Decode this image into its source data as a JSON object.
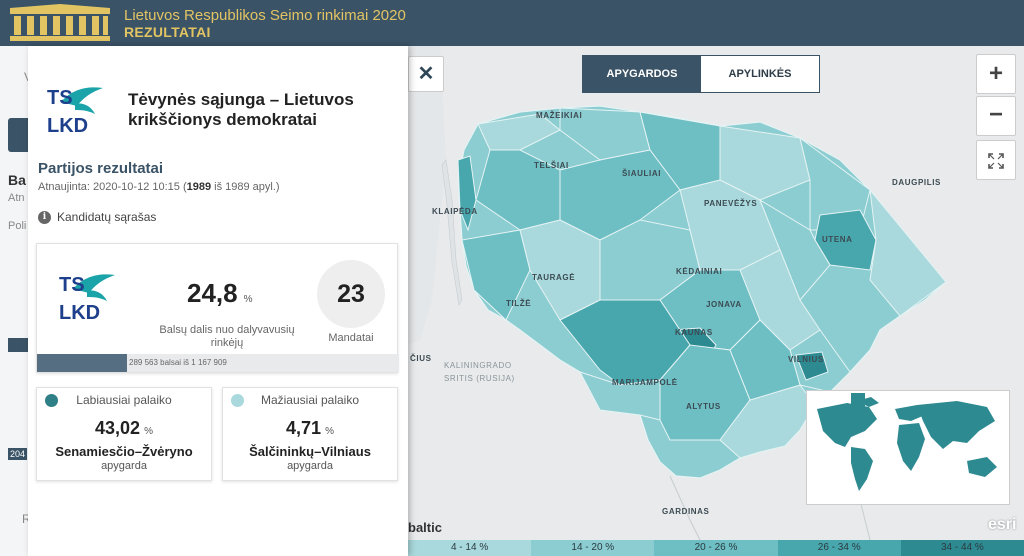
{
  "header": {
    "title": "Lietuvos Respublikos Seimo rinkimai 2020",
    "subtitle": "REZULTATAI"
  },
  "background_page": {
    "labels": [
      "V",
      "Ba",
      "Atn",
      "Poli",
      "204",
      "R"
    ]
  },
  "panel": {
    "party_logo_text": [
      "TS",
      "LKD"
    ],
    "party_name": "Tėvynės sąjunga – Lietuvos krikščionys demokratai",
    "section_title": "Partijos rezultatai",
    "updated_prefix": "Atnaujinta: 2020-10-12 10:15 (",
    "updated_count": "1989",
    "updated_suffix": " iš 1989 apyl.)",
    "candidates_link": "Kandidatų sąrašas",
    "result": {
      "vote_share": "24,8",
      "unit": "%",
      "vote_share_label": "Balsų dalis nuo dalyvavusių rinkėjų",
      "seats": "23",
      "seats_label": "Mandatai",
      "votes_text": "289 563 balsai iš 1 167 909",
      "bar_fraction": 0.248
    },
    "most_support": {
      "title": "Labiausiai palaiko",
      "value": "43,02",
      "unit": "%",
      "district": "Senamiesčio–Žvėryno",
      "type": "apygarda",
      "dot_color": "#2e7f86"
    },
    "least_support": {
      "title": "Mažiausiai palaiko",
      "value": "4,71",
      "unit": "%",
      "district": "Šalčininkų–Vilniaus",
      "type": "apygarda",
      "dot_color": "#a9d9dc"
    }
  },
  "map": {
    "close_label": "✕",
    "toggle": {
      "left": "APYGARDOS",
      "right": "APYLINKĖS"
    },
    "zoom_in": "+",
    "zoom_out": "−",
    "fullscreen": "⛶",
    "place_labels": [
      "MAŽEIKIAI",
      "TELŠIAI",
      "ŠIAULIAI",
      "PANEVĖŽYS",
      "KLAIPĖDA",
      "UTENA",
      "DAUGPILIS",
      "TAURAGĖ",
      "KĖDAINIAI",
      "JONAVA",
      "TILŽĖ",
      "KAUNAS",
      "VILNIUS",
      "MARIJAMPOLĖ",
      "ALYTUS",
      "GARDINAS",
      "ČIUS"
    ],
    "region_label": [
      "KALININGRADO",
      "SRITIS (RUSIJA)"
    ],
    "attribution_left": "baltic",
    "attribution_right": "esri",
    "legend": [
      {
        "label": "4 - 14 %",
        "color": "#a9d9dc"
      },
      {
        "label": "14 - 20 %",
        "color": "#8ccdd1"
      },
      {
        "label": "20 - 26 %",
        "color": "#6dbfc4"
      },
      {
        "label": "26 - 34 %",
        "color": "#48a7ad"
      },
      {
        "label": "34 - 44 %",
        "color": "#2e8a91"
      }
    ]
  },
  "colors": {
    "header_bg": "#3a5366",
    "header_text": "#e2c463",
    "accent": "#3a5366"
  }
}
